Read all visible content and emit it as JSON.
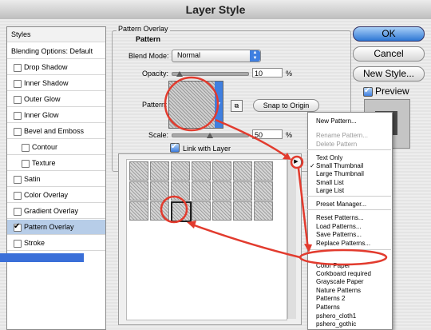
{
  "window": {
    "title": "Layer Style"
  },
  "styles_list": {
    "header": "Styles",
    "blending": "Blending Options: Default",
    "items": [
      {
        "label": "Drop Shadow",
        "checked": false
      },
      {
        "label": "Inner Shadow",
        "checked": false
      },
      {
        "label": "Outer Glow",
        "checked": false
      },
      {
        "label": "Inner Glow",
        "checked": false
      },
      {
        "label": "Bevel and Emboss",
        "checked": false
      },
      {
        "label": "Contour",
        "checked": false
      },
      {
        "label": "Texture",
        "checked": false
      },
      {
        "label": "Satin",
        "checked": false
      },
      {
        "label": "Color Overlay",
        "checked": false
      },
      {
        "label": "Gradient Overlay",
        "checked": false
      },
      {
        "label": "Pattern Overlay",
        "checked": true
      },
      {
        "label": "Stroke",
        "checked": false
      }
    ]
  },
  "panel": {
    "group_title": "Pattern Overlay",
    "sub_title": "Pattern",
    "blend_mode_label": "Blend Mode:",
    "blend_mode_value": "Normal",
    "opacity_label": "Opacity:",
    "opacity_value": "10",
    "opacity_unit": "%",
    "opacity_level": 0.1,
    "pattern_label": "Pattern:",
    "snap_button": "Snap to Origin",
    "scale_label": "Scale:",
    "scale_value": "50",
    "scale_unit": "%",
    "scale_level": 0.5,
    "link_label": "Link with Layer",
    "link_checked": true
  },
  "buttons": {
    "ok": "OK",
    "cancel": "Cancel",
    "new_style": "New Style...",
    "preview": "Preview"
  },
  "picker_menu": {
    "items": [
      {
        "label": "New Pattern...",
        "disabled": false
      },
      {
        "label": "Rename Pattern...",
        "disabled": true
      },
      {
        "label": "Delete Pattern",
        "disabled": true
      },
      {
        "label": "Text Only",
        "disabled": false
      },
      {
        "label": "Small Thumbnail",
        "disabled": false,
        "checked": true
      },
      {
        "label": "Large Thumbnail",
        "disabled": false
      },
      {
        "label": "Small List",
        "disabled": false
      },
      {
        "label": "Large List",
        "disabled": false
      },
      {
        "label": "Preset Manager...",
        "disabled": false
      },
      {
        "label": "Reset Patterns...",
        "disabled": false
      },
      {
        "label": "Load Patterns...",
        "disabled": false
      },
      {
        "label": "Save Patterns...",
        "disabled": false
      },
      {
        "label": "Replace Patterns...",
        "disabled": false
      },
      {
        "label": "Artist Surfaces",
        "disabled": false,
        "highlighted": true
      },
      {
        "label": "Color Paper",
        "disabled": false
      },
      {
        "label": "Corkboard required",
        "disabled": false
      },
      {
        "label": "Grayscale Paper",
        "disabled": false
      },
      {
        "label": "Nature Patterns",
        "disabled": false
      },
      {
        "label": "Patterns 2",
        "disabled": false
      },
      {
        "label": "Patterns",
        "disabled": false
      },
      {
        "label": "pshero_cloth1",
        "disabled": false
      },
      {
        "label": "pshero_gothic",
        "disabled": false
      }
    ],
    "check_mark": "✓"
  },
  "colors": {
    "accent": "#3f7fe0",
    "highlight": "#3a6fd8",
    "annotation": "#e23b2e"
  }
}
